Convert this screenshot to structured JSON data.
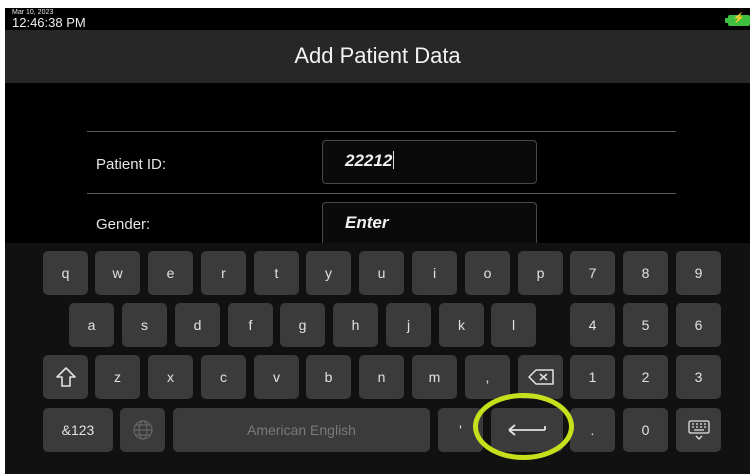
{
  "status": {
    "date": "Mar 10, 2023",
    "time": "12:46:38 PM",
    "battery_icon": "battery-charging-icon"
  },
  "header": {
    "title": "Add Patient Data"
  },
  "form": {
    "patient_id": {
      "label": "Patient ID:",
      "value": "22212"
    },
    "gender": {
      "label": "Gender:",
      "value": "Enter"
    }
  },
  "keyboard": {
    "row1": [
      "q",
      "w",
      "e",
      "r",
      "t",
      "y",
      "u",
      "i",
      "o",
      "p"
    ],
    "row1_num": [
      "7",
      "8",
      "9"
    ],
    "row2": [
      "a",
      "s",
      "d",
      "f",
      "g",
      "h",
      "j",
      "k",
      "l"
    ],
    "row2_num": [
      "4",
      "5",
      "6"
    ],
    "row3": [
      "z",
      "x",
      "c",
      "v",
      "b",
      "n",
      "m",
      ","
    ],
    "row3_num": [
      "1",
      "2",
      "3"
    ],
    "symbols_label": "&123",
    "space_label": "American English",
    "apostrophe": "'",
    "period": ".",
    "zero": "0",
    "icons": {
      "shift": "shift-arrow-icon",
      "backspace": "backspace-icon",
      "globe": "globe-icon",
      "enter": "enter-arrow-icon",
      "keyboard_hide": "keyboard-hide-icon"
    }
  },
  "annotation": {
    "color": "#c6e01c"
  }
}
